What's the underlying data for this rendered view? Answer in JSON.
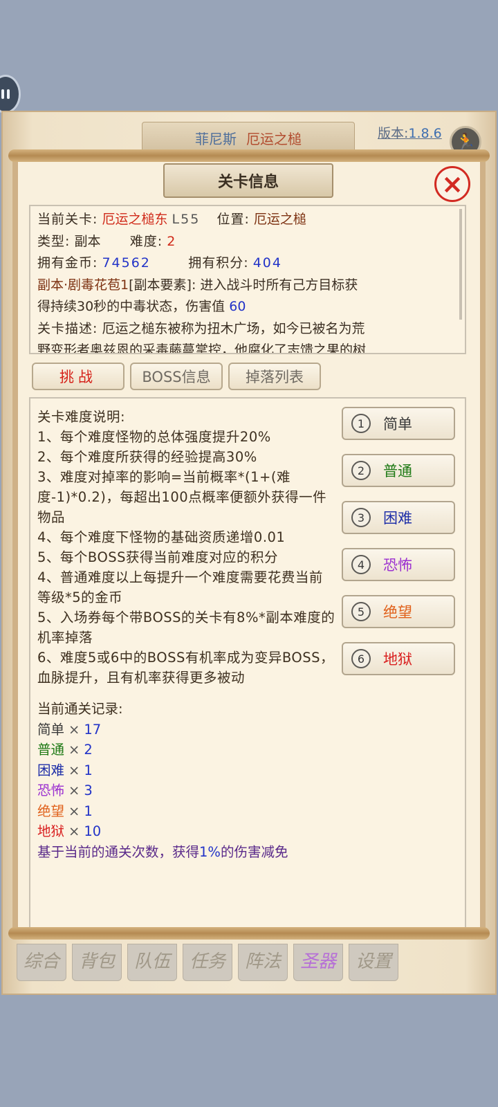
{
  "header": {
    "player_name": "菲尼斯",
    "location_name": "厄运之槌",
    "version_label": "版本:",
    "version_value": "1.8.6"
  },
  "panel": {
    "title": "关卡信息",
    "close_icon": "close-icon"
  },
  "info": {
    "current_stage_label": "当前关卡:",
    "current_stage_value": "厄运之槌东",
    "level": "L55",
    "position_label": "位置:",
    "position_value": "厄运之槌",
    "type_label": "类型:",
    "type_value": "副本",
    "difficulty_label": "难度:",
    "difficulty_value": "2",
    "gold_label": "拥有金币:",
    "gold_value": "74562",
    "points_label": "拥有积分:",
    "points_value": "404",
    "element_name": "副本·剧毒花苞1",
    "element_tag": "[副本要素]:",
    "element_desc_1": "进入战斗时所有己方目标获",
    "element_desc_2": "得持续30秒的中毒状态，伤害值",
    "element_damage": "60",
    "desc_label": "关卡描述:",
    "desc_line_1": "厄运之槌东被称为扭木广场，如今已被名为荒",
    "desc_line_2": "野变形者奥兹恩的采毒藤蔓掌控，他腐化了志馈之果的树"
  },
  "tabs": [
    {
      "label": "挑战"
    },
    {
      "label": "BOSS信息"
    },
    {
      "label": "掉落列表"
    }
  ],
  "difficulty_notes": [
    "关卡难度说明:",
    "1、每个难度怪物的总体强度提升20%",
    "2、每个难度所获得的经验提高30%",
    "3、难度对掉率的影响=当前概率*(1+(难度-1)*0.2)，每超出100点概率便额外获得一件物品",
    "4、每个难度下怪物的基础资质递增0.01",
    "5、每个BOSS获得当前难度对应的积分",
    "4、普通难度以上每提升一个难度需要花费当前等级*5的金币",
    "5、入场券每个带BOSS的关卡有8%*副本难度的机率掉落",
    "6、难度5或6中的BOSS有机率成为变异BOSS，血脉提升，且有机率获得更多被动"
  ],
  "difficulties": [
    {
      "num": "1",
      "label": "简单",
      "color": "#3a3a3a"
    },
    {
      "num": "2",
      "label": "普通",
      "color": "#1f7a16"
    },
    {
      "num": "3",
      "label": "困难",
      "color": "#1f2fa8"
    },
    {
      "num": "4",
      "label": "恐怖",
      "color": "#9b2fd0"
    },
    {
      "num": "5",
      "label": "绝望",
      "color": "#e0601a"
    },
    {
      "num": "6",
      "label": "地狱",
      "color": "#d92020"
    }
  ],
  "records": {
    "title": "当前通关记录:",
    "items": [
      {
        "label": "简单",
        "count": "17"
      },
      {
        "label": "普通",
        "count": "2"
      },
      {
        "label": "困难",
        "count": "1"
      },
      {
        "label": "恐怖",
        "count": "3"
      },
      {
        "label": "绝望",
        "count": "1"
      },
      {
        "label": "地狱",
        "count": "10"
      }
    ],
    "mult": "×",
    "bonus_prefix": "基于当前的通关次数，获得",
    "bonus_value": "1%",
    "bonus_suffix": "的伤害减免"
  },
  "bottom_nav": [
    "综合",
    "背包",
    "队伍",
    "任务",
    "阵法",
    "圣器",
    "设置"
  ]
}
